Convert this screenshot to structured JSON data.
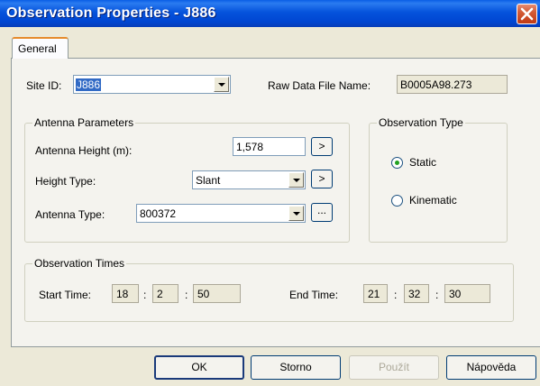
{
  "window": {
    "title": "Observation Properties - J886"
  },
  "tabs": [
    {
      "label": "General"
    }
  ],
  "site": {
    "id_label": "Site ID:",
    "id_value": "J886",
    "raw_label": "Raw Data File Name:",
    "raw_value": "B0005A98.273"
  },
  "antenna": {
    "group_title": "Antenna Parameters",
    "height_label": "Antenna Height (m):",
    "height_value": "1,578",
    "height_btn": ">",
    "height_type_label": "Height Type:",
    "height_type_value": "Slant",
    "height_type_btn": ">",
    "type_label": "Antenna Type:",
    "type_value": "800372",
    "type_btn": "..."
  },
  "obs_type": {
    "group_title": "Observation Type",
    "options": [
      {
        "label": "Static",
        "checked": true
      },
      {
        "label": "Kinematic",
        "checked": false
      }
    ]
  },
  "times": {
    "group_title": "Observation Times",
    "start_label": "Start Time:",
    "start": [
      "18",
      "2",
      "50"
    ],
    "end_label": "End Time:",
    "end": [
      "21",
      "32",
      "30"
    ],
    "separator": ":"
  },
  "buttons": {
    "ok": "OK",
    "cancel": "Storno",
    "apply": "Použít",
    "help": "Nápověda"
  }
}
